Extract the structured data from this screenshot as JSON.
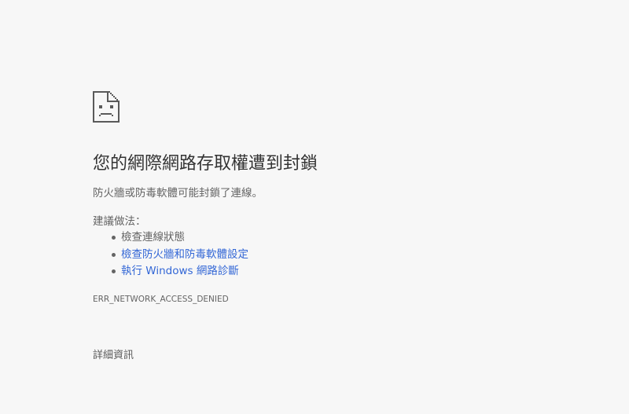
{
  "error_page": {
    "icon": "sad-document-icon",
    "title": "您的網際網路存取權遭到封鎖",
    "description": "防火牆或防毒軟體可能封鎖了連線。",
    "suggestions_heading": "建議做法：",
    "suggestions": [
      {
        "label": "檢查連線狀態",
        "is_link": false
      },
      {
        "label": "檢查防火牆和防毒軟體設定",
        "is_link": true
      },
      {
        "label": "執行 Windows 網路診斷",
        "is_link": true
      }
    ],
    "error_code": "ERR_NETWORK_ACCESS_DENIED",
    "details_label": "詳細資訊"
  },
  "colors": {
    "background": "#f7f7f7",
    "title": "#333333",
    "text": "#646464",
    "link": "#3367d6"
  }
}
